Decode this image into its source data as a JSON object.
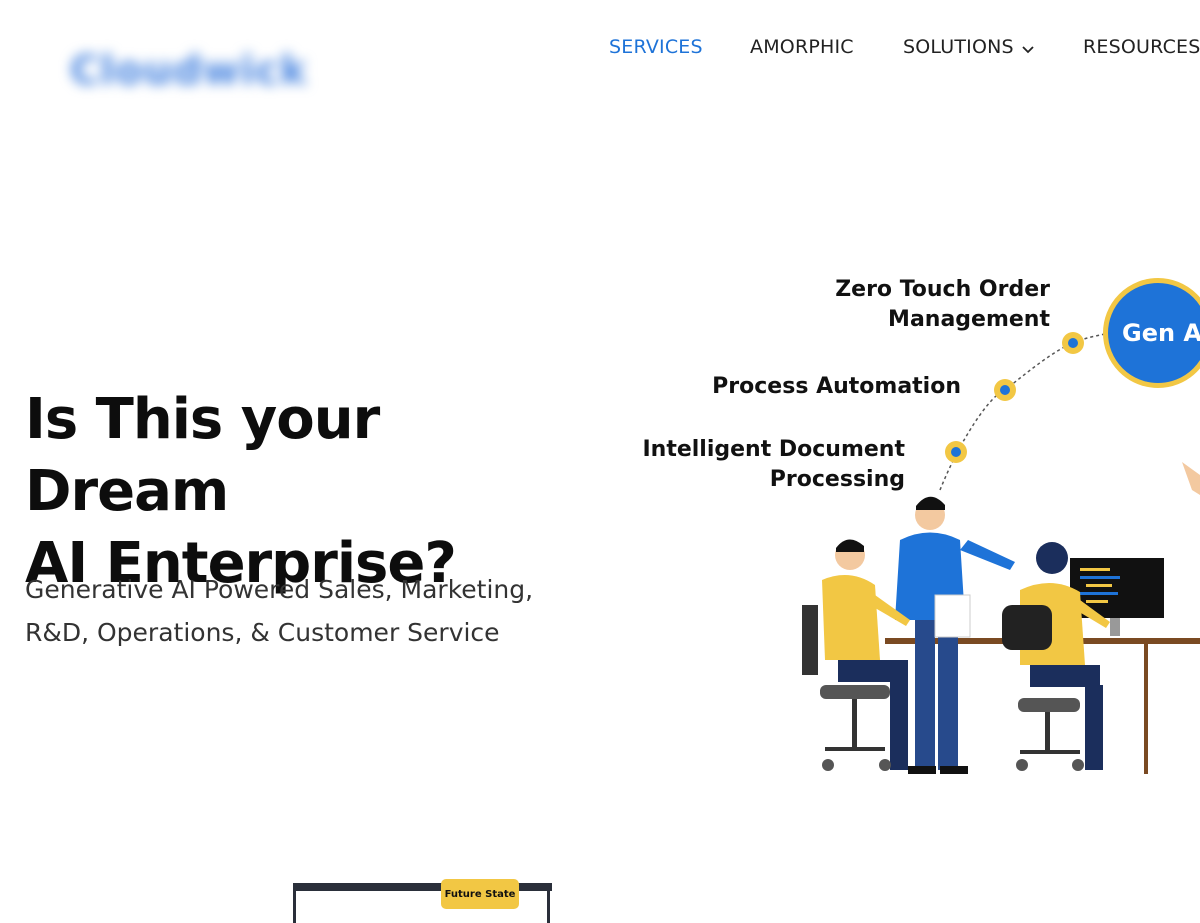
{
  "header": {
    "logo_text": "Cloudwick",
    "nav": [
      {
        "label": "SERVICES",
        "active": true
      },
      {
        "label": "AMORPHIC",
        "active": false
      },
      {
        "label": "SOLUTIONS",
        "active": false
      },
      {
        "label": "RESOURCES",
        "active": false
      }
    ]
  },
  "hero": {
    "title_line1": "Is This your Dream",
    "title_line2": "AI Enterprise?",
    "subtitle_line1": "Generative AI Powered Sales, Marketing,",
    "subtitle_line2": "R&D, Operations, & Customer Service"
  },
  "illustration": {
    "genai_label": "Gen AI",
    "milestones": [
      {
        "line1": "Zero Touch Order",
        "line2": "Management"
      },
      {
        "line1": "Process Automation",
        "line2": ""
      },
      {
        "line1": "Intelligent Document",
        "line2": "Processing"
      }
    ]
  },
  "lower": {
    "future_state_label": "Future State"
  },
  "colors": {
    "accent_blue": "#1e73d8",
    "accent_yellow": "#f2c744",
    "text_dark": "#0d0d0d"
  }
}
